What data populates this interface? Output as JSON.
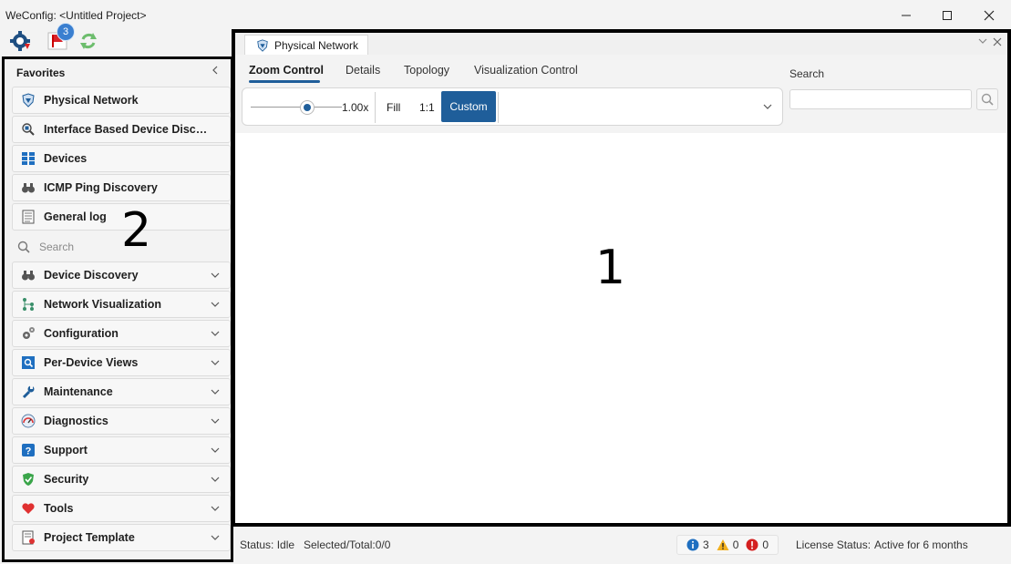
{
  "window": {
    "title": "WeConfig: <Untitled Project>",
    "minimize_icon": "minimize-icon",
    "maximize_icon": "maximize-icon",
    "close_icon": "close-icon"
  },
  "toolbar": {
    "notification_count": "3",
    "icons": [
      "settings-gear-icon",
      "flag-icon",
      "refresh-icon"
    ]
  },
  "left_panel": {
    "header": "Favorites",
    "favorites": [
      {
        "label": "Physical Network",
        "icon": "physical-network-icon"
      },
      {
        "label": "Interface Based Device Discov...",
        "icon": "interface-discovery-icon"
      },
      {
        "label": "Devices",
        "icon": "devices-grid-icon"
      },
      {
        "label": "ICMP Ping Discovery",
        "icon": "binoculars-icon"
      },
      {
        "label": "General log",
        "icon": "log-icon"
      }
    ],
    "search_placeholder": "Search",
    "groups": [
      {
        "label": "Device Discovery",
        "icon": "binoculars-icon"
      },
      {
        "label": "Network Visualization",
        "icon": "network-nodes-icon"
      },
      {
        "label": "Configuration",
        "icon": "gears-icon"
      },
      {
        "label": "Per-Device Views",
        "icon": "device-view-icon"
      },
      {
        "label": "Maintenance",
        "icon": "wrench-icon"
      },
      {
        "label": "Diagnostics",
        "icon": "gauge-icon"
      },
      {
        "label": "Support",
        "icon": "question-icon"
      },
      {
        "label": "Security",
        "icon": "shield-icon"
      },
      {
        "label": "Tools",
        "icon": "heart-icon"
      },
      {
        "label": "Project Template",
        "icon": "template-icon"
      }
    ],
    "annotation": "2"
  },
  "main": {
    "document_tab": "Physical Network",
    "ribbon_tabs": [
      "Zoom Control",
      "Details",
      "Topology",
      "Visualization Control"
    ],
    "active_ribbon_tab": "Zoom Control",
    "zoom": {
      "value_label": "1.00x",
      "fill_label": "Fill",
      "one_to_one_label": "1:1",
      "custom_label": "Custom"
    },
    "search_label": "Search",
    "search_value": "",
    "annotation": "1"
  },
  "status": {
    "status_text": "Status: Idle",
    "selected_text": "Selected/Total:0/0",
    "info_count": "3",
    "warning_count": "0",
    "error_count": "0",
    "license_label": "License Status:",
    "license_value": "Active for 6 months"
  },
  "colors": {
    "accent": "#1f5e9a",
    "badge": "#3a7fd0",
    "annotation_border": "#000000"
  }
}
